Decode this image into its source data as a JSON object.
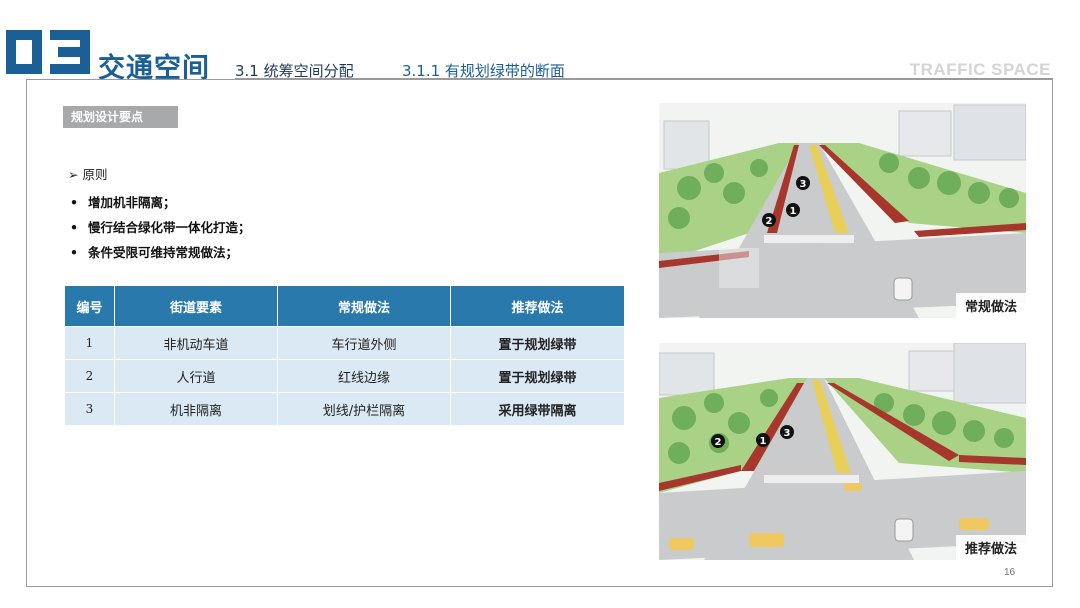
{
  "header": {
    "section_number": "03",
    "section_title": "交通空间",
    "sub_section": "3.1 统筹空间分配",
    "sub_sub_section": "3.1.1 有规划绿带的断面",
    "english_title": "TRAFFIC SPACE"
  },
  "content": {
    "tag_label": "规划设计要点",
    "principle_heading": "原则",
    "bullets": [
      "增加机非隔离；",
      "慢行结合绿化带一体化打造；",
      "条件受限可维持常规做法；"
    ]
  },
  "table": {
    "headers": [
      "编号",
      "街道要素",
      "常规做法",
      "推荐做法"
    ],
    "rows": [
      [
        "1",
        "非机动车道",
        "车行道外侧",
        "置于规划绿带"
      ],
      [
        "2",
        "人行道",
        "红线边缘",
        "置于规划绿带"
      ],
      [
        "3",
        "机非隔离",
        "划线/护栏隔离",
        "采用绿带隔离"
      ]
    ]
  },
  "images": {
    "top": {
      "label": "常规做法",
      "markers": [
        "3",
        "1",
        "2"
      ]
    },
    "bottom": {
      "label": "推荐做法",
      "markers": [
        "2",
        "1",
        "3"
      ]
    }
  },
  "colors": {
    "brand_blue": "#1a5f96",
    "table_header": "#2979ad",
    "table_cell": "#dbe9f5",
    "bike_lane_red": "#a7362c"
  },
  "page_number": "16"
}
